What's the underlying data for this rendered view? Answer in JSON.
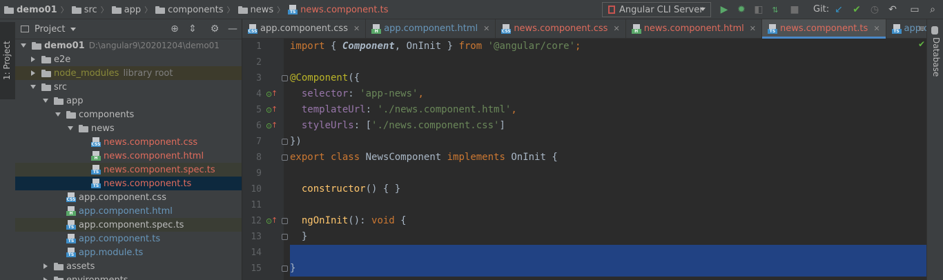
{
  "breadcrumbs": [
    "demo01",
    "src",
    "app",
    "components",
    "news",
    "news.component.ts"
  ],
  "run_config": {
    "label": "Angular CLI Server"
  },
  "toolbar": {
    "git_label": "Git:"
  },
  "left_tool_tab": "1: Project",
  "project_panel": {
    "title": "Project",
    "root": {
      "name": "demo01",
      "path": "D:\\angular9\\20201204\\demo01"
    },
    "items": [
      {
        "label": "e2e",
        "hint": ""
      },
      {
        "label": "node_modules",
        "hint": "library root"
      },
      {
        "label": "src",
        "hint": ""
      },
      {
        "label": "app",
        "hint": ""
      },
      {
        "label": "components",
        "hint": ""
      },
      {
        "label": "news",
        "hint": ""
      },
      {
        "label": "news.component.css",
        "hint": ""
      },
      {
        "label": "news.component.html",
        "hint": ""
      },
      {
        "label": "news.component.spec.ts",
        "hint": ""
      },
      {
        "label": "news.component.ts",
        "hint": ""
      },
      {
        "label": "app.component.css",
        "hint": ""
      },
      {
        "label": "app.component.html",
        "hint": ""
      },
      {
        "label": "app.component.spec.ts",
        "hint": ""
      },
      {
        "label": "app.component.ts",
        "hint": ""
      },
      {
        "label": "app.module.ts",
        "hint": ""
      },
      {
        "label": "assets",
        "hint": ""
      },
      {
        "label": "environments",
        "hint": ""
      }
    ]
  },
  "tabs": [
    {
      "label": "app.component.css"
    },
    {
      "label": "app.component.html"
    },
    {
      "label": "news.component.css"
    },
    {
      "label": "news.component.html"
    },
    {
      "label": "news.component.ts"
    },
    {
      "label": "app.compon"
    }
  ],
  "tab_overflow": "≡",
  "right_tool_tab": "Database",
  "editor": {
    "line_numbers": [
      "1",
      "2",
      "3",
      "4",
      "5",
      "6",
      "7",
      "8",
      "9",
      "10",
      "11",
      "12",
      "13",
      "14",
      "15"
    ],
    "code": {
      "l1_import": "import",
      "l1_a": " { ",
      "l1_component": "Component",
      "l1_b": ", OnInit } ",
      "l1_from": "from",
      "l1_sp": " ",
      "l1_str": "'@angular/core'",
      "l1_end": ";",
      "l3_ann": "@Component",
      "l3_rest": "({",
      "l4_key": "  selector",
      "l4_colon": ": ",
      "l4_val": "'app-news'",
      "l4_comma": ",",
      "l5_key": "  templateUrl",
      "l5_colon": ": ",
      "l5_val": "'./news.component.html'",
      "l5_comma": ",",
      "l6_key": "  styleUrls",
      "l6_a": ": [",
      "l6_val": "'./news.component.css'",
      "l6_b": "]",
      "l7": "})",
      "l8_export": "export",
      "l8_sp1": " ",
      "l8_class": "class",
      "l8_name": " NewsComponent ",
      "l8_impl": "implements",
      "l8_rest": " OnInit {",
      "l10_fn": "  constructor",
      "l10_rest": "() { }",
      "l12_fn": "  ngOnInit",
      "l12_a": "(): ",
      "l12_void": "void",
      "l12_b": " {",
      "l13": "  }",
      "l15": "}"
    }
  },
  "colors": {
    "background": "#2b2b2b",
    "panel": "#3c3f41",
    "selection": "#214283",
    "keyword": "#cc7832",
    "string": "#6a8759",
    "annotation": "#bbb529",
    "function": "#ffc66d",
    "modified_file": "#e06c5d",
    "new_file": "#6897bb"
  }
}
